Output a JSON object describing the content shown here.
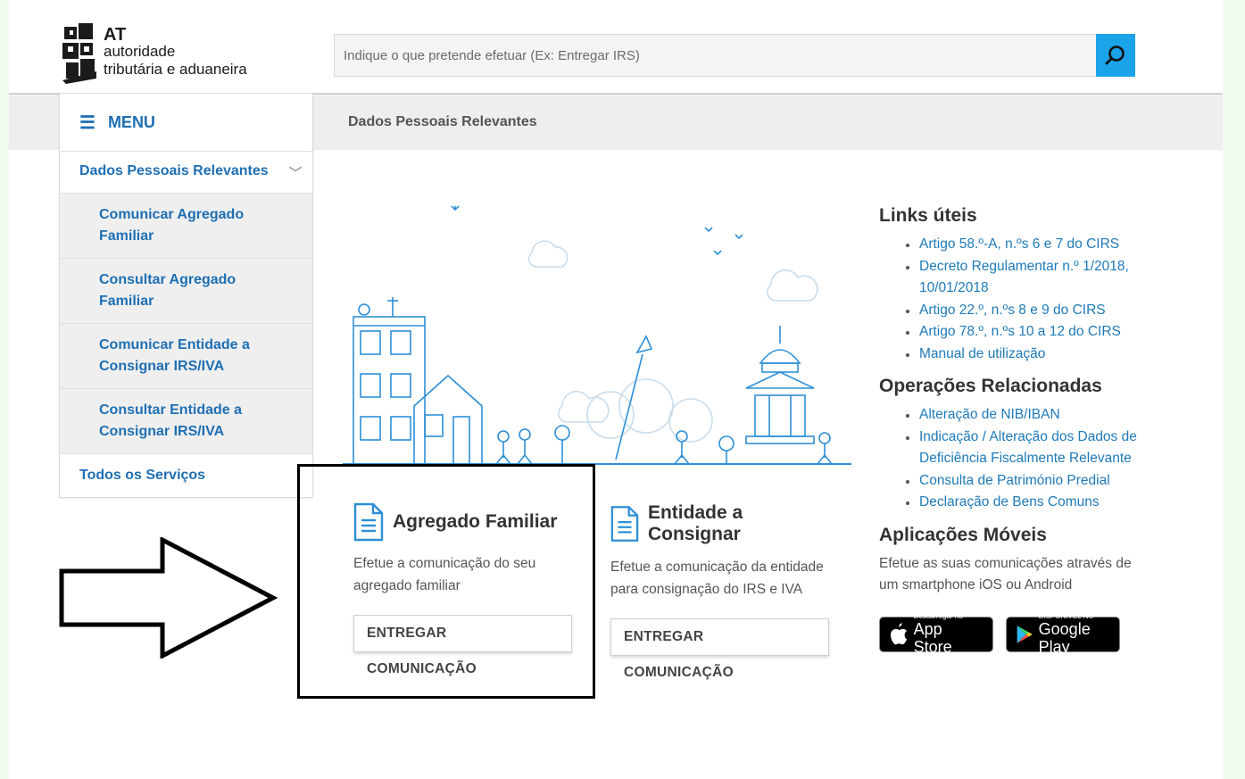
{
  "header": {
    "logo": {
      "at": "AT",
      "line1": "autoridade",
      "line2": "tributária e aduaneira"
    },
    "search": {
      "placeholder": "Indique o que pretende efetuar (Ex: Entregar IRS)",
      "value": "",
      "icon": "search-icon"
    }
  },
  "breadcrumb": {
    "title": "Dados Pessoais Relevantes"
  },
  "sidebar": {
    "menu_label": "MENU",
    "items": [
      {
        "label": "Dados Pessoais Relevantes",
        "type": "parent"
      },
      {
        "label": "Comunicar Agregado Familiar",
        "type": "sub"
      },
      {
        "label": "Consultar Agregado Familiar",
        "type": "sub"
      },
      {
        "label": "Comunicar Entidade a Consignar IRS/IVA",
        "type": "sub"
      },
      {
        "label": "Consultar Entidade a Consignar IRS/IVA",
        "type": "sub"
      },
      {
        "label": "Todos os Serviços",
        "type": "top"
      }
    ]
  },
  "cards": [
    {
      "title": "Agregado Familiar",
      "description": "Efetue a comunicação do seu agregado familiar",
      "button": "ENTREGAR COMUNICAÇÃO"
    },
    {
      "title": "Entidade a Consignar",
      "description": "Efetue a comunicação da entidade para consignação do IRS e IVA",
      "button": "ENTREGAR COMUNICAÇÃO"
    }
  ],
  "links_uteis": {
    "heading": "Links úteis",
    "items": [
      "Artigo 58.º-A, n.ºs 6 e 7 do CIRS",
      "Decreto Regulamentar n.º 1/2018, 10/01/2018",
      "Artigo 22.º, n.ºs 8 e 9 do CIRS",
      "Artigo 78.º, n.ºs 10 a 12 do CIRS",
      "Manual de utilização"
    ]
  },
  "operacoes": {
    "heading": "Operações Relacionadas",
    "items": [
      "Alteração de NIB/IBAN",
      "Indicação / Alteração dos Dados de Deficiência Fiscalmente Relevante",
      "Consulta de Património Predial",
      "Declaração de Bens Comuns"
    ]
  },
  "aplicacoes": {
    "heading": "Aplicações Móveis",
    "text": "Efetue as suas comunicações através de um smartphone iOS ou Android",
    "appstore": {
      "small": "Descarregar na",
      "big": "App Store"
    },
    "googleplay": {
      "small": "DISPONÍVEL NO",
      "big": "Google Play"
    }
  },
  "colors": {
    "link": "#1e7ab8",
    "accent": "#1aa3e8",
    "sidebar_link": "#1e6fb3"
  }
}
